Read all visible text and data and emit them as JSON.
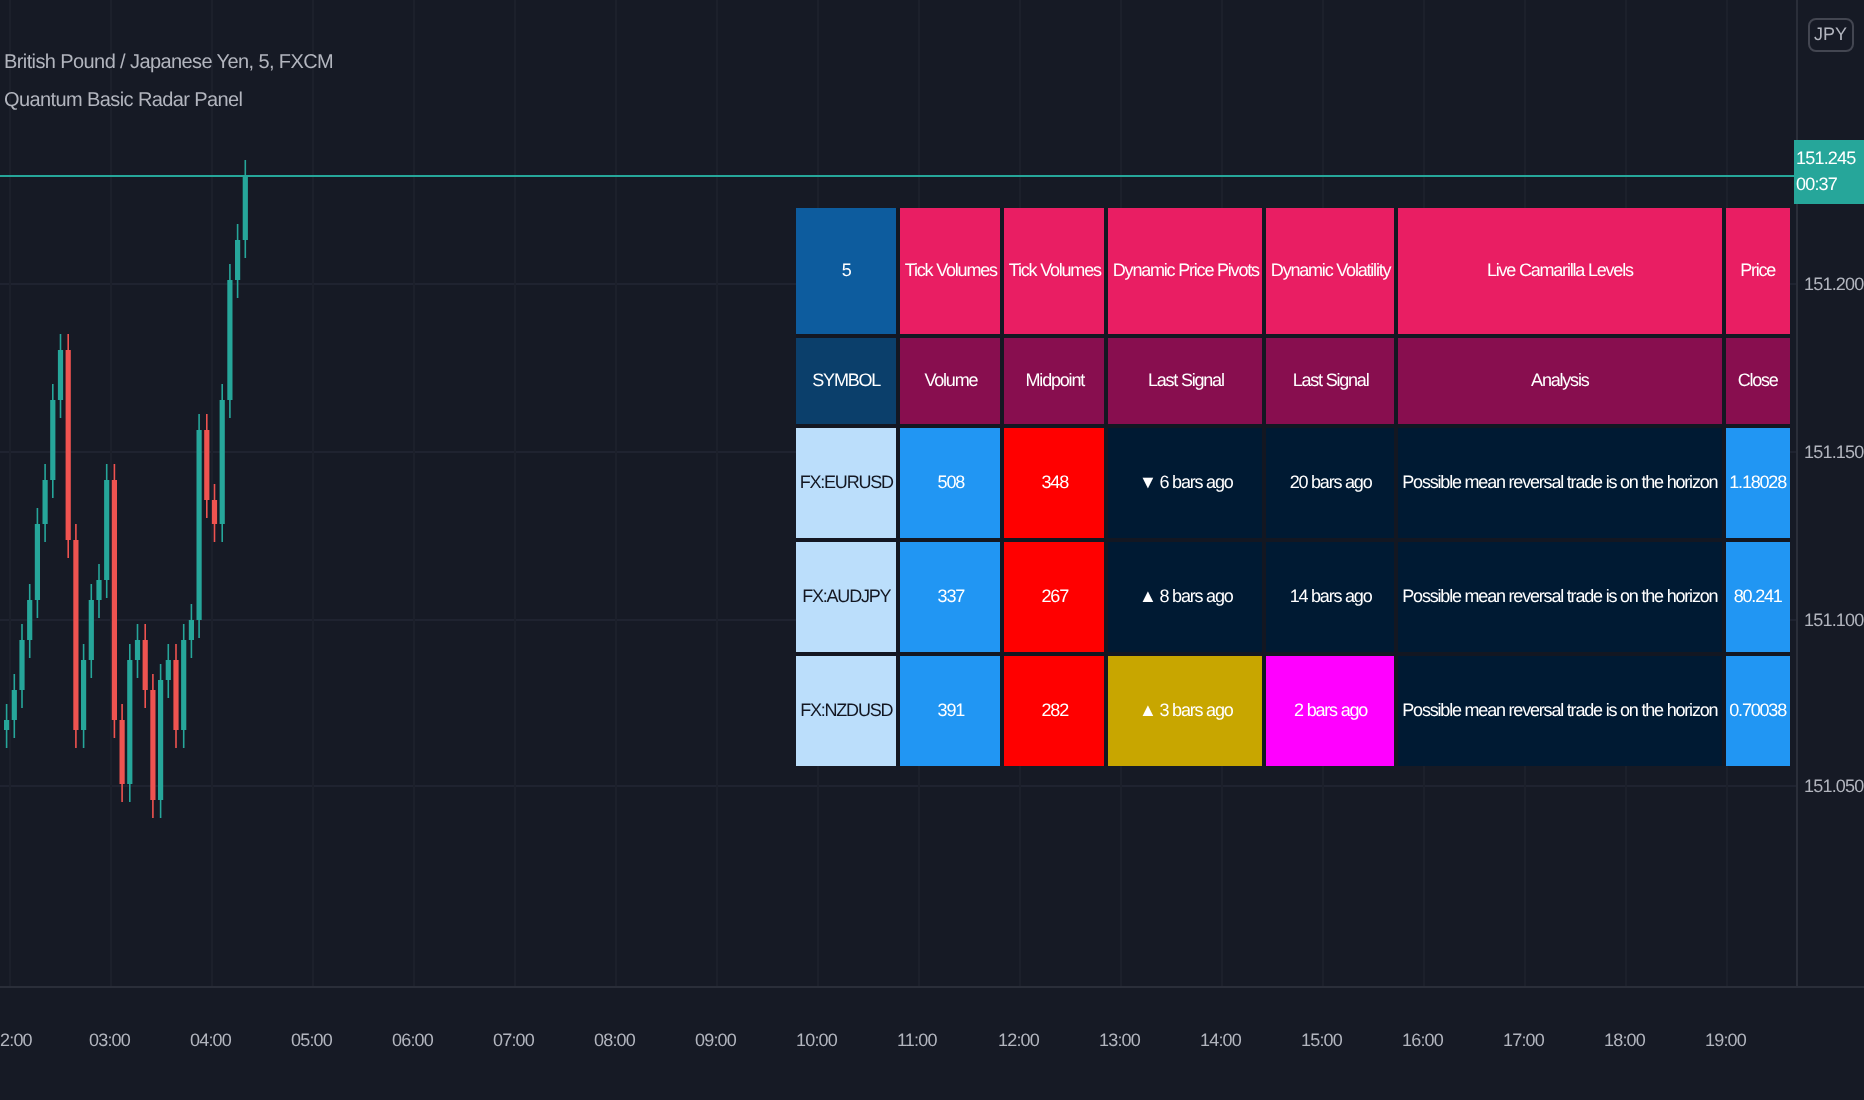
{
  "legend": {
    "title": "British Pound / Japanese Yen, 5, FXCM",
    "indicator": "Quantum Basic Radar Panel"
  },
  "price_axis": {
    "currency": "JPY",
    "current_price": "151.245",
    "countdown": "00:37",
    "ticks": [
      "151.200",
      "151.150",
      "151.100",
      "151.050"
    ]
  },
  "time_axis": {
    "ticks": [
      "2:00",
      "03:00",
      "04:00",
      "05:00",
      "06:00",
      "07:00",
      "08:00",
      "09:00",
      "10:00",
      "11:00",
      "12:00",
      "13:00",
      "14:00",
      "15:00",
      "16:00",
      "17:00",
      "18:00",
      "19:00"
    ]
  },
  "table": {
    "header_rows": [
      [
        {
          "text": "5",
          "color": "#0d5c9e"
        },
        {
          "text": "Tick Volumes",
          "color": "#e91e63"
        },
        {
          "text": "Tick Volumes",
          "color": "#e91e63"
        },
        {
          "text": "Dynamic Price Pivots",
          "color": "#e91e63"
        },
        {
          "text": "Dynamic Volatility",
          "color": "#e91e63"
        },
        {
          "text": "Live Camarilla Levels",
          "color": "#e91e63"
        },
        {
          "text": "Price",
          "color": "#e91e63"
        }
      ],
      [
        {
          "text": "SYMBOL",
          "color": "#0b3f6b"
        },
        {
          "text": "Volume",
          "color": "#880e4f"
        },
        {
          "text": "Midpoint",
          "color": "#880e4f"
        },
        {
          "text": "Last Signal",
          "color": "#880e4f"
        },
        {
          "text": "Last Signal",
          "color": "#880e4f"
        },
        {
          "text": "Analysis",
          "color": "#880e4f"
        },
        {
          "text": "Close",
          "color": "#880e4f"
        }
      ]
    ],
    "rows": [
      {
        "cells": [
          {
            "text": "FX:EURUSD",
            "color": "#bbdefb"
          },
          {
            "text": "508",
            "color": "#2196f3"
          },
          {
            "text": "348",
            "color": "#ff0000"
          },
          {
            "text": "▼ 6 bars ago",
            "color": "#001a33"
          },
          {
            "text": "20 bars ago",
            "color": "#001a33"
          },
          {
            "text": "Possible mean reversal trade is on the horizon",
            "color": "#001a33"
          },
          {
            "text": "1.18028",
            "color": "#2196f3"
          }
        ]
      },
      {
        "cells": [
          {
            "text": "FX:AUDJPY",
            "color": "#bbdefb"
          },
          {
            "text": "337",
            "color": "#2196f3"
          },
          {
            "text": "267",
            "color": "#ff0000"
          },
          {
            "text": "▲ 8 bars ago",
            "color": "#001a33"
          },
          {
            "text": "14 bars ago",
            "color": "#001a33"
          },
          {
            "text": "Possible mean reversal trade is on the horizon",
            "color": "#001a33"
          },
          {
            "text": "80.241",
            "color": "#2196f3"
          }
        ]
      },
      {
        "cells": [
          {
            "text": "FX:NZDUSD",
            "color": "#bbdefb"
          },
          {
            "text": "391",
            "color": "#2196f3"
          },
          {
            "text": "282",
            "color": "#ff0000"
          },
          {
            "text": "▲ 3 bars ago",
            "color": "#c8a600"
          },
          {
            "text": "2 bars ago",
            "color": "#ff00ff"
          },
          {
            "text": "Possible mean reversal trade is on the horizon",
            "color": "#001a33"
          },
          {
            "text": "0.70038",
            "color": "#2196f3"
          }
        ]
      }
    ]
  }
}
